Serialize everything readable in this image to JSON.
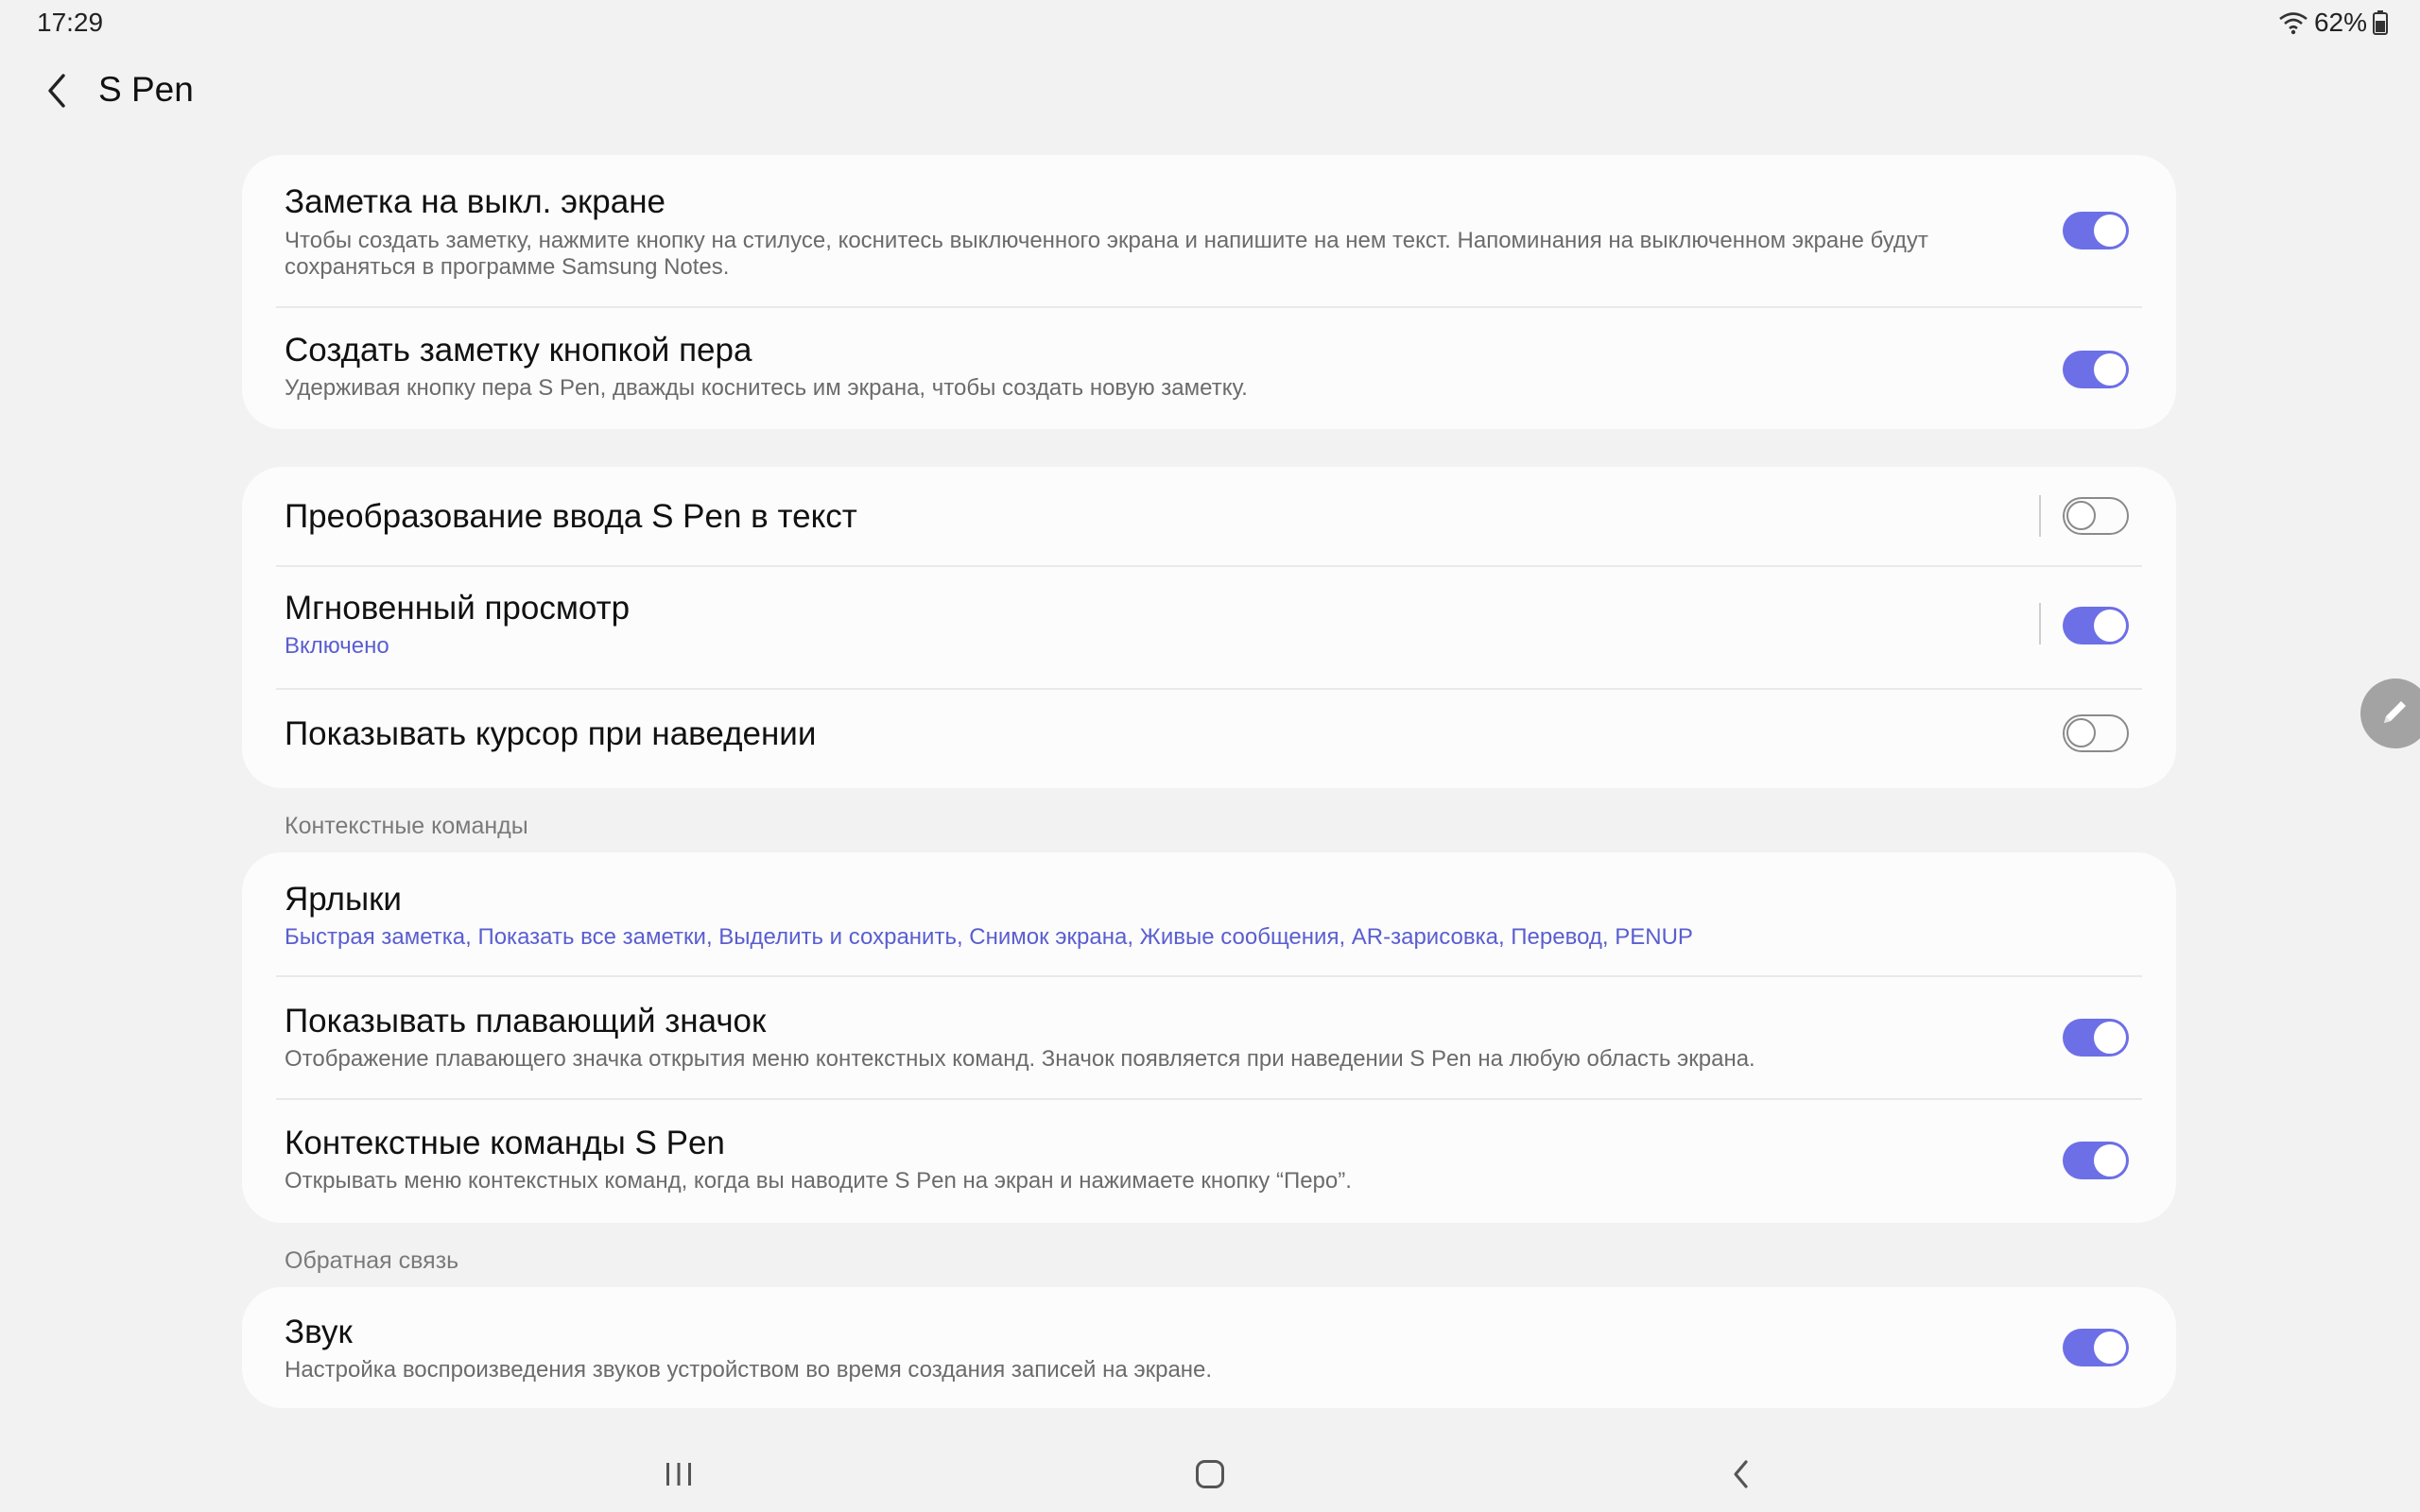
{
  "status": {
    "time": "17:29",
    "battery": "62%"
  },
  "header": {
    "title": "S Pen"
  },
  "group1": {
    "items": [
      {
        "title": "Заметка на выкл. экране",
        "subtitle": "Чтобы создать заметку, нажмите кнопку на стилусе, коснитесь выключенного экрана и напишите на нем текст. Напоминания на выключенном экране будут сохраняться в программе Samsung Notes.",
        "toggle": "on"
      },
      {
        "title": "Создать заметку кнопкой пера",
        "subtitle": "Удерживая кнопку пера S Pen, дважды коснитесь им экрана, чтобы создать новую заметку.",
        "toggle": "on"
      }
    ]
  },
  "group2": {
    "items": [
      {
        "title": "Преобразование ввода S Pen в текст",
        "toggle": "off"
      },
      {
        "title": "Мгновенный просмотр",
        "subtitle": "Включено",
        "toggle": "on"
      },
      {
        "title": "Показывать курсор при наведении",
        "toggle": "off"
      }
    ]
  },
  "section_context": {
    "header": "Контекстные команды"
  },
  "group3": {
    "items": [
      {
        "title": "Ярлыки",
        "subtitle": "Быстрая заметка, Показать все заметки, Выделить и сохранить, Снимок экрана, Живые сообщения, AR-зарисовка, Перевод, PENUP"
      },
      {
        "title": "Показывать плавающий значок",
        "subtitle": "Отображение плавающего значка открытия меню контекстных команд. Значок появляется при наведении S Pen на любую область экрана.",
        "toggle": "on"
      },
      {
        "title": "Контекстные команды S Pen",
        "subtitle": "Открывать меню контекстных команд, когда вы наводите S Pen на экран и нажимаете кнопку “Перо”.",
        "toggle": "on"
      }
    ]
  },
  "section_feedback": {
    "header": "Обратная связь"
  },
  "group4": {
    "items": [
      {
        "title": "Звук",
        "subtitle": "Настройка воспроизведения звуков устройством во время создания записей на экране.",
        "toggle": "on"
      }
    ]
  },
  "icons": {
    "back": "chevron-left-icon",
    "floating": "pen-icon",
    "nav_recents": "recents-icon",
    "nav_home": "home-icon",
    "nav_back": "back-icon"
  },
  "colors": {
    "accent": "#6c6fe6",
    "background": "#f2f2f2",
    "card": "#fcfcfc"
  }
}
